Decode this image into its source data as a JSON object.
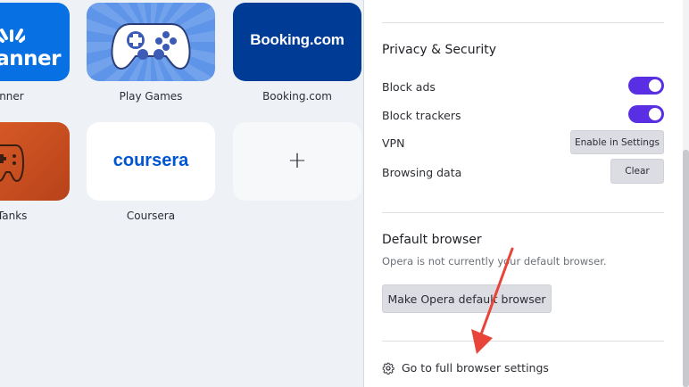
{
  "speed_dial": {
    "tiles": [
      {
        "label": "canner",
        "brand_text": "canner"
      },
      {
        "label": "Play Games"
      },
      {
        "label": "Booking.com",
        "brand_text": "Booking.com"
      },
      {
        "label": "of Tanks"
      },
      {
        "label": "Coursera",
        "brand_text": "coursera"
      },
      {
        "label": "",
        "icon": "plus-icon",
        "symbol": "+"
      }
    ]
  },
  "privacy": {
    "title": "Privacy & Security",
    "block_ads": {
      "label": "Block ads",
      "enabled": true
    },
    "block_trackers": {
      "label": "Block trackers",
      "enabled": true
    },
    "vpn": {
      "label": "VPN",
      "button": "Enable in Settings"
    },
    "browsing_data": {
      "label": "Browsing data",
      "button": "Clear"
    }
  },
  "default_browser": {
    "title": "Default browser",
    "description": "Opera is not currently your default browser.",
    "button": "Make Opera default browser"
  },
  "footer": {
    "icon": "gear-icon",
    "link": "Go to full browser settings"
  },
  "colors": {
    "toggle_on": "#5a2ee2",
    "arrow": "#e8443a",
    "booking_blue": "#003b95",
    "coursera_blue": "#0056d2",
    "skyscanner_blue": "#0770e3"
  }
}
